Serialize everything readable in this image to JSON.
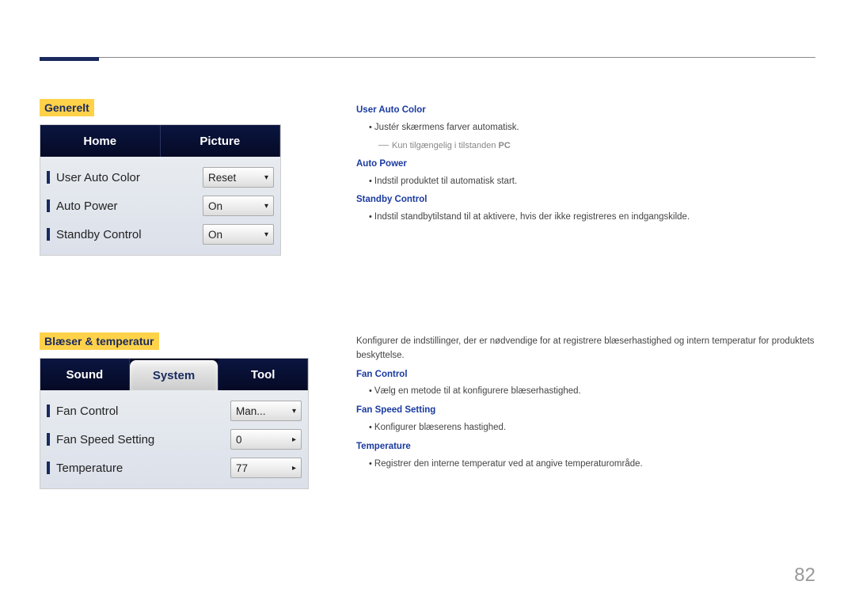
{
  "page_number": "82",
  "section1": {
    "title": "Generelt",
    "tabs": [
      "Home",
      "Picture"
    ],
    "rows": [
      {
        "label": "User Auto Color",
        "value": "Reset",
        "glyph": "▾"
      },
      {
        "label": "Auto Power",
        "value": "On",
        "glyph": "▾"
      },
      {
        "label": "Standby Control",
        "value": "On",
        "glyph": "▾"
      }
    ],
    "desc": {
      "h1": "User Auto Color",
      "b1": "Justér skærmens farver automatisk.",
      "n1": "Kun tilgængelig i tilstanden ",
      "n1b": "PC",
      "h2": "Auto Power",
      "b2": "Indstil produktet til automatisk start.",
      "h3": "Standby Control",
      "b3": "Indstil standbytilstand til at aktivere, hvis der ikke registreres en indgangskilde."
    }
  },
  "section2": {
    "title": "Blæser & temperatur",
    "tabs": [
      "Sound",
      "System",
      "Tool"
    ],
    "active_tab": 1,
    "rows": [
      {
        "label": "Fan Control",
        "value": "Man...",
        "glyph": "▾"
      },
      {
        "label": "Fan Speed Setting",
        "value": "0",
        "glyph": "▸"
      },
      {
        "label": "Temperature",
        "value": "77",
        "glyph": "▸"
      }
    ],
    "desc": {
      "intro": "Konfigurer de indstillinger, der er nødvendige for at registrere blæserhastighed og intern temperatur for produktets beskyttelse.",
      "h1": "Fan Control",
      "b1": "Vælg en metode til at konfigurere blæserhastighed.",
      "h2": "Fan Speed Setting",
      "b2": "Konfigurer blæserens hastighed.",
      "h3": "Temperature",
      "b3": "Registrer den interne temperatur ved at angive temperaturområde."
    }
  }
}
